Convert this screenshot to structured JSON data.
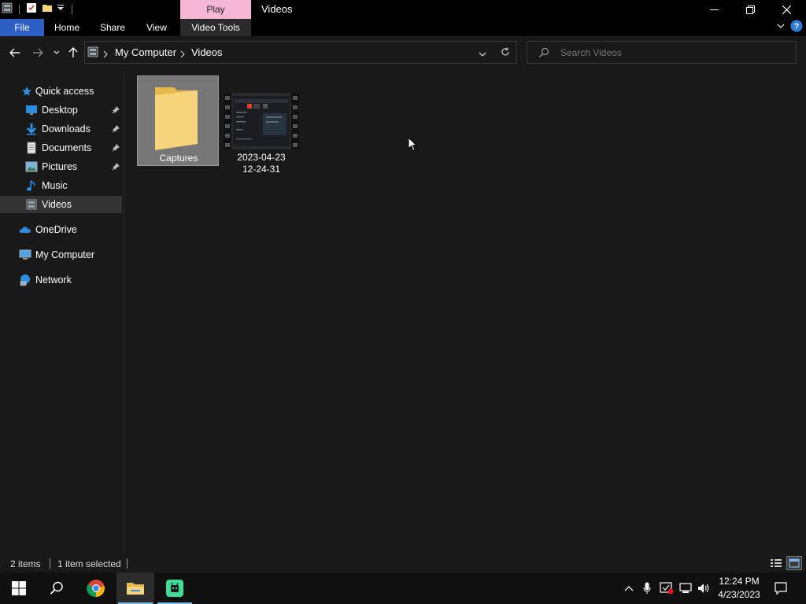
{
  "window": {
    "title": "Videos",
    "context_tab": "Play",
    "controls": {
      "minimize": "—",
      "restore": "❐",
      "close": "✕"
    }
  },
  "ribbon": {
    "tabs": [
      "File",
      "Home",
      "Share",
      "View",
      "Video Tools"
    ]
  },
  "address": {
    "breadcrumbs": [
      "My Computer",
      "Videos"
    ]
  },
  "search": {
    "placeholder": "Search Videos"
  },
  "sidebar": {
    "quick_access": "Quick access",
    "items": [
      {
        "label": "Desktop",
        "icon": "desktop-icon",
        "pinned": true
      },
      {
        "label": "Downloads",
        "icon": "downloads-icon",
        "pinned": true
      },
      {
        "label": "Documents",
        "icon": "documents-icon",
        "pinned": true
      },
      {
        "label": "Pictures",
        "icon": "pictures-icon",
        "pinned": true
      },
      {
        "label": "Music",
        "icon": "music-icon",
        "pinned": false
      },
      {
        "label": "Videos",
        "icon": "videos-icon",
        "pinned": false,
        "selected": true
      }
    ],
    "onedrive": "OneDrive",
    "my_computer": "My Computer",
    "network": "Network"
  },
  "files": [
    {
      "name": "Captures",
      "type": "folder",
      "selected": true
    },
    {
      "name_line1": "2023-04-23",
      "name_line2": "12-24-31",
      "type": "video",
      "selected": false
    }
  ],
  "status": {
    "count": "2 items",
    "selection": "1 item selected"
  },
  "taskbar": {
    "apps": [
      "start-icon",
      "search-icon",
      "chrome-icon",
      "file-explorer-icon",
      "app-icon"
    ],
    "clock_time": "12:24 PM",
    "clock_date": "4/23/2023"
  },
  "colors": {
    "file_tab": "#2b5fc4",
    "context_tab": "#f4b6d4",
    "background": "#191919",
    "selection": "#777777",
    "accent": "#76b9ed"
  }
}
